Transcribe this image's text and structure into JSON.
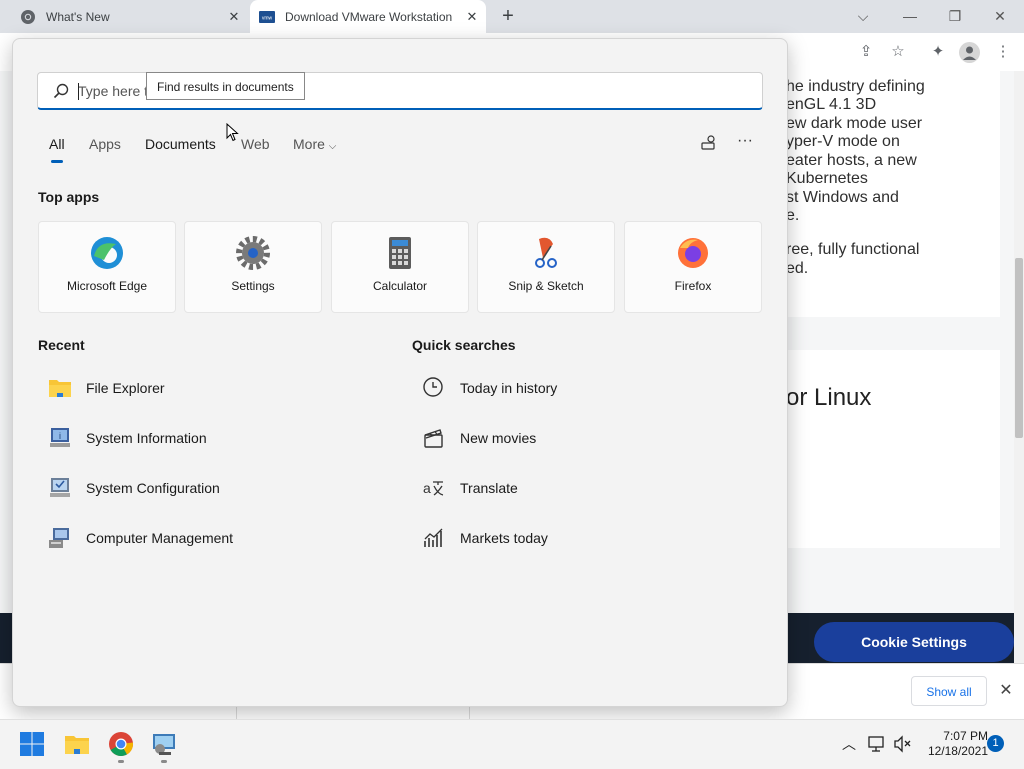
{
  "browser": {
    "tabs": [
      {
        "title": "What's New",
        "favicon": "chrome-icon"
      },
      {
        "title": "Download VMware Workstation",
        "favicon": "vmware-icon",
        "active": true
      }
    ],
    "new_tab": "+",
    "window_controls": [
      "chevron-down-icon",
      "minimize-icon",
      "restore-icon",
      "close-icon"
    ],
    "toolbar_icons": [
      "share-icon",
      "star-icon",
      "extensions-icon",
      "profile-icon",
      "menu-icon"
    ]
  },
  "webpage": {
    "lines": [
      "he industry defining",
      "enGL 4.1 3D",
      "ew dark mode user",
      "yper-V mode on",
      "eater hosts, a new",
      "Kubernetes",
      "st Windows and",
      "e.",
      "ree, fully functional",
      "ed."
    ],
    "heading": "or Linux",
    "cookie_button": "Cookie Settings",
    "download_bar": {
      "show_all": "Show all",
      "close": "✕"
    }
  },
  "search": {
    "placeholder": "Type here to search",
    "visible_text": "Type here t",
    "tooltip": "Find results in documents",
    "tabs": [
      "All",
      "Apps",
      "Documents",
      "Web",
      "More"
    ],
    "active_tab": "All",
    "top_apps_title": "Top apps",
    "top_apps": [
      {
        "label": "Microsoft Edge",
        "icon": "edge-icon"
      },
      {
        "label": "Settings",
        "icon": "settings-gear-icon"
      },
      {
        "label": "Calculator",
        "icon": "calculator-icon"
      },
      {
        "label": "Snip & Sketch",
        "icon": "snip-sketch-icon"
      },
      {
        "label": "Firefox",
        "icon": "firefox-icon"
      }
    ],
    "recent_title": "Recent",
    "recent": [
      {
        "label": "File Explorer",
        "icon": "folder-icon"
      },
      {
        "label": "System Information",
        "icon": "system-information-icon"
      },
      {
        "label": "System Configuration",
        "icon": "system-configuration-icon"
      },
      {
        "label": "Computer Management",
        "icon": "computer-management-icon"
      }
    ],
    "quick_title": "Quick searches",
    "quick": [
      {
        "label": "Today in history",
        "icon": "clock-icon"
      },
      {
        "label": "New movies",
        "icon": "clapperboard-icon"
      },
      {
        "label": "Translate",
        "icon": "translate-icon"
      },
      {
        "label": "Markets today",
        "icon": "chart-icon"
      }
    ]
  },
  "taskbar": {
    "apps": [
      "windows-start-icon",
      "file-explorer-icon",
      "chrome-icon",
      "vmware-installer-icon"
    ],
    "tray_icons": [
      "chevron-up-icon",
      "network-icon",
      "volume-muted-icon"
    ],
    "time": "7:07 PM",
    "date": "12/18/2021",
    "notification_count": "1"
  },
  "colors": {
    "accent": "#005fb8",
    "cookie_button": "#1a3f9c",
    "cookie_bar": "#16202e"
  }
}
